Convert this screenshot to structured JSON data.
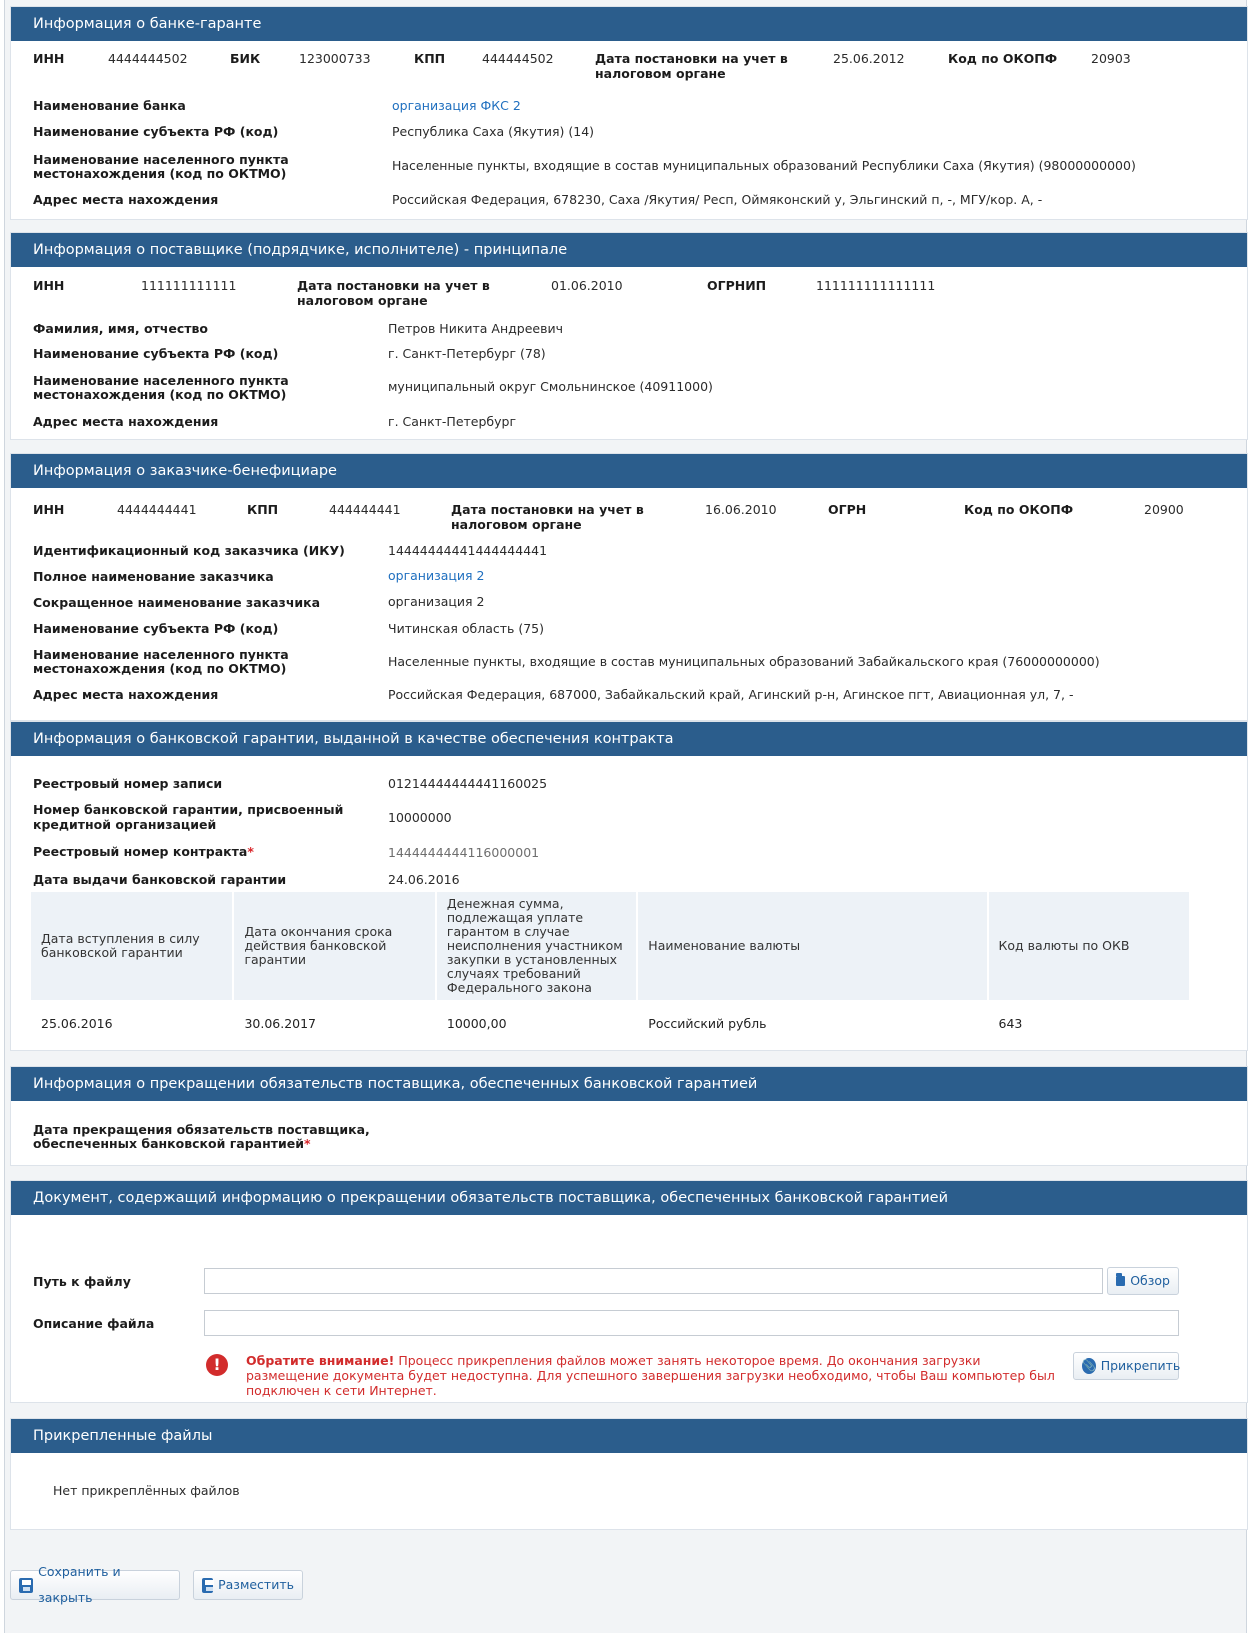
{
  "bank": {
    "title": "Информация о банке-гаранте",
    "inn_label": "ИНН",
    "inn": "4444444502",
    "bik_label": "БИК",
    "bik": "123000733",
    "kpp_label": "КПП",
    "kpp": "444444502",
    "reg_label_1": "Дата постановки на учет в",
    "reg_label_2": "налоговом органе",
    "reg_date": "25.06.2012",
    "okopf_label": "Код по ОКОПФ",
    "okopf": "20903",
    "name_label": "Наименование банка",
    "name": "организация ФКС 2",
    "subject_label": "Наименование субъекта РФ (код)",
    "subject": "Республика Саха (Якутия) (14)",
    "locality_label_1": "Наименование населенного пункта",
    "locality_label_2": "местонахождения (код по ОКТМО)",
    "locality": "Населенные пункты, входящие в состав муниципальных образований Республики Саха (Якутия) (98000000000)",
    "address_label": "Адрес места нахождения",
    "address": "Российская Федерация, 678230, Саха /Якутия/ Респ, Оймяконский у, Эльгинский п, -, МГУ/кор. А, -"
  },
  "supplier": {
    "title": "Информация о поставщике (подрядчике, исполнителе) - принципале",
    "inn_label": "ИНН",
    "inn": "111111111111",
    "reg_label_1": "Дата постановки на учет в",
    "reg_label_2": "налоговом органе",
    "reg_date": "01.06.2010",
    "ogrnip_label": "ОГРНИП",
    "ogrnip": "111111111111111",
    "fio_label": "Фамилия, имя, отчество",
    "fio": "Петров Никита Андреевич",
    "subject_label": "Наименование субъекта РФ (код)",
    "subject": "г. Санкт-Петербург (78)",
    "locality_label_1": "Наименование населенного пункта",
    "locality_label_2": "местонахождения (код по ОКТМО)",
    "locality": "муниципальный округ Смольнинское (40911000)",
    "address_label": "Адрес места нахождения",
    "address": "г. Санкт-Петербург"
  },
  "customer": {
    "title": "Информация о заказчике-бенефициаре",
    "inn_label": "ИНН",
    "inn": "4444444441",
    "kpp_label": "КПП",
    "kpp": "444444441",
    "reg_label_1": "Дата постановки на учет в",
    "reg_label_2": "налоговом органе",
    "reg_date": "16.06.2010",
    "ogrn_label": "ОГРН",
    "okopf_label": "Код по ОКОПФ",
    "okopf": "20900",
    "iku_label": "Идентификационный код заказчика (ИКУ)",
    "iku": "14444444441444444441",
    "full_name_label": "Полное наименование заказчика",
    "full_name": "организация 2",
    "short_name_label": "Сокращенное наименование заказчика",
    "short_name": "организация 2",
    "subject_label": "Наименование субъекта РФ (код)",
    "subject": "Читинская область (75)",
    "locality_label_1": "Наименование населенного пункта",
    "locality_label_2": "местонахождения (код по ОКТМО)",
    "locality": "Населенные пункты, входящие в состав муниципальных образований Забайкальского края (76000000000)",
    "address_label": "Адрес места нахождения",
    "address": "Российская Федерация, 687000, Забайкальский край, Агинский р-н, Агинское пгт, Авиационная ул, 7, -"
  },
  "guarantee": {
    "title": "Информация о банковской гарантии, выданной в качестве обеспечения контракта",
    "registry_label": "Реестровый номер записи",
    "registry": "01214444444441160025",
    "number_label_1": "Номер банковской гарантии, присвоенный",
    "number_label_2": "кредитной организацией",
    "number": "10000000",
    "contract_label": "Реестровый номер контракта",
    "required_mark": "*",
    "contract": "1444444444116000001",
    "issue_label": "Дата выдачи банковской гарантии",
    "issue_date": "24.06.2016",
    "table_headers": [
      "Дата вступления в силу банковской гарантии",
      "Дата окончания срока действия банковской гарантии",
      "Денежная сумма, подлежащая уплате гарантом в случае неисполнения участником закупки в установленных случаях требований Федерального закона",
      "Наименование валюты",
      "Код валюты по ОКВ"
    ],
    "table_row": [
      "25.06.2016",
      "30.06.2017",
      "10000,00",
      "Российский рубль",
      "643"
    ]
  },
  "termination": {
    "title": "Информация о прекращении обязательств поставщика, обеспеченных банковской гарантией",
    "date_label_1": "Дата прекращения обязательств поставщика,",
    "date_label_2": "обеспеченных банковской гарантией",
    "required_mark": "*"
  },
  "document": {
    "title": "Документ, содержащий информацию о прекращении обязательств поставщика, обеспеченных банковской гарантией",
    "path_label": "Путь к файлу",
    "path_value": "",
    "browse_label": "Обзор",
    "desc_label": "Описание файла",
    "desc_value": "",
    "warn_bold": "Обратите внимание!",
    "warn_text": " Процесс прикрепления файлов может занять некоторое время. До окончания загрузки размещение документа будет недоступна. Для успешного завершения загрузки необходимо, чтобы Ваш компьютер был подключен к сети Интернет.",
    "attach_label": "Прикрепить"
  },
  "attached": {
    "title": "Прикрепленные файлы",
    "empty": "Нет прикреплённых файлов"
  },
  "footer": {
    "save_close_label": "Сохранить и закрыть",
    "publish_label": "Разместить"
  }
}
